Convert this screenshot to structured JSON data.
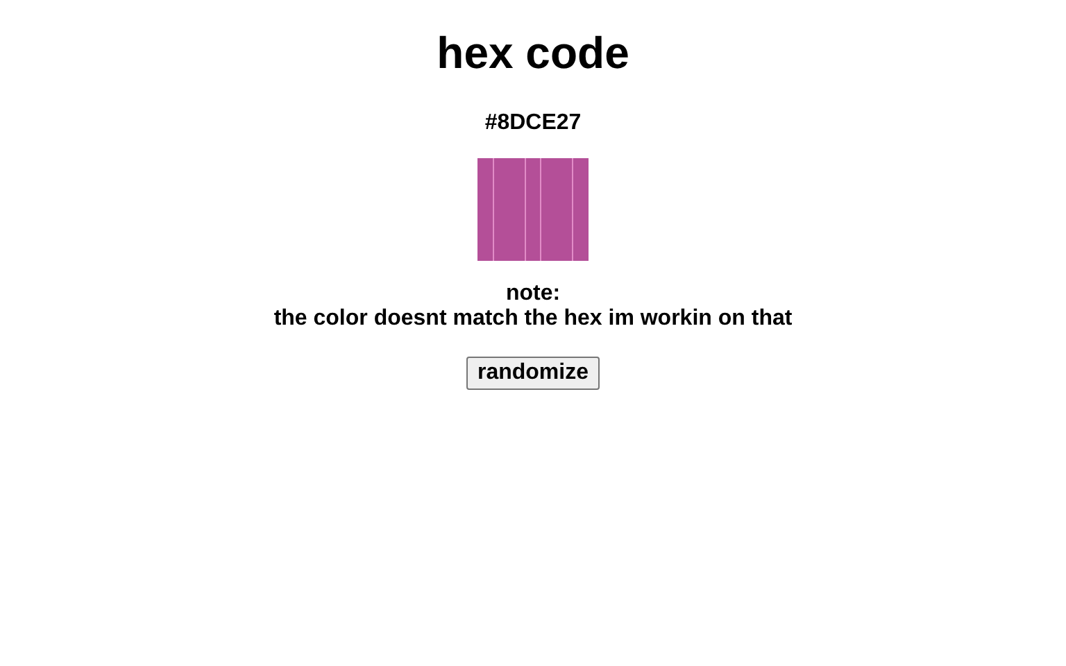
{
  "title": "hex code",
  "hex": "#8DCE27",
  "swatch": {
    "color": "#b44f98"
  },
  "note": {
    "label": "note:",
    "text": "the color doesnt match the hex im workin on that"
  },
  "button": "randomize"
}
